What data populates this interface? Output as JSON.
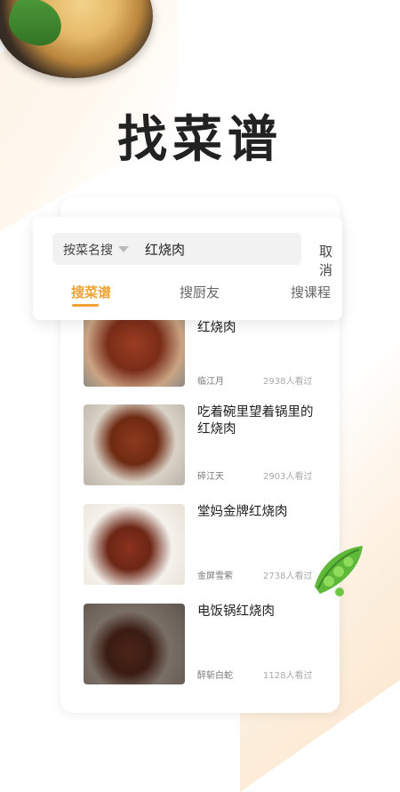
{
  "page": {
    "title": "找菜谱"
  },
  "search": {
    "type_label": "按菜名搜",
    "query": "红烧肉",
    "cancel_label": "取消"
  },
  "tabs": [
    {
      "label": "搜菜谱",
      "active": true
    },
    {
      "label": "搜厨友",
      "active": false
    },
    {
      "label": "搜课程",
      "active": false
    }
  ],
  "results": [
    {
      "title": "红烧肉",
      "author": "临江月",
      "views": "2938人看过"
    },
    {
      "title": "吃着碗里望着锅里的红烧肉",
      "author": "碎江天",
      "views": "2903人看过"
    },
    {
      "title": "堂妈金牌红烧肉",
      "author": "金屏雪萦",
      "views": "2738人看过"
    },
    {
      "title": "电饭锅红烧肉",
      "author": "醉斩白蛇",
      "views": "1128人看过"
    }
  ],
  "colors": {
    "accent": "#f0a232",
    "title": "#222222",
    "background_tint": "#fdf1e2"
  },
  "icons": {
    "dropdown": "caret-down-icon",
    "decoration": "pea-pod-icon"
  }
}
